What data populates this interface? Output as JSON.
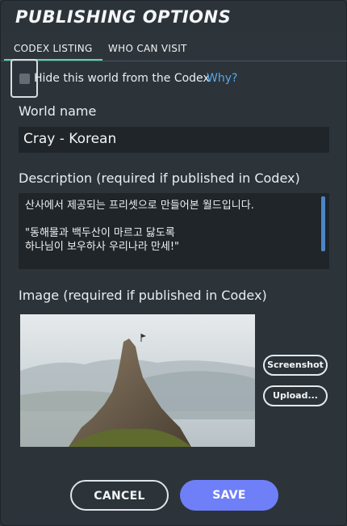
{
  "dialog": {
    "title": "PUBLISHING OPTIONS",
    "tabs": [
      {
        "label": "CODEX LISTING",
        "active": true
      },
      {
        "label": "WHO CAN VISIT",
        "active": false
      }
    ]
  },
  "visibility": {
    "hide_label": "Hide this world from the Codex",
    "why_link": "Why?",
    "checked": false
  },
  "world_name": {
    "label": "World name",
    "value": "Cray - Korean"
  },
  "description": {
    "label": "Description (required if published in Codex)",
    "lines": [
      "산사에서 제공되는 프리셋으로 만들어본 월드입니다.",
      "",
      "\"동해물과 백두산이 마르고 닳도록",
      "하나님이 보우하사 우리나라 만세!\""
    ]
  },
  "image": {
    "label": "Image (required if published in Codex)",
    "screenshot_button": "Screenshot",
    "upload_button": "Upload..."
  },
  "actions": {
    "cancel": "CANCEL",
    "save": "SAVE"
  },
  "colors": {
    "accent_tab": "#5fd6a8",
    "link": "#5aa8e8",
    "save_button": "#6f7ff7"
  }
}
